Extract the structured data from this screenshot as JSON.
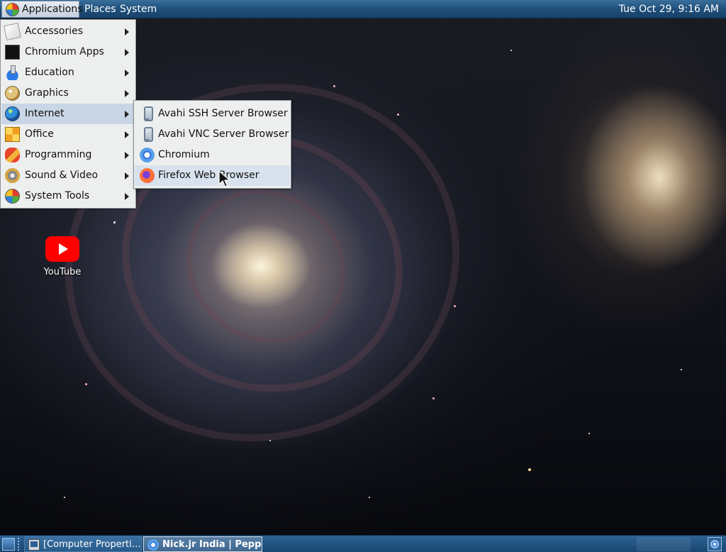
{
  "top_panel": {
    "menus": {
      "applications": "Applications",
      "places": "Places",
      "system": "System"
    },
    "clock": "Tue Oct 29,  9:16 AM"
  },
  "applications_menu": {
    "items": [
      {
        "label": "Accessories",
        "icon": "accessories-icon"
      },
      {
        "label": "Chromium Apps",
        "icon": "chromium-apps-icon"
      },
      {
        "label": "Education",
        "icon": "education-icon"
      },
      {
        "label": "Graphics",
        "icon": "graphics-icon"
      },
      {
        "label": "Internet",
        "icon": "internet-globe-icon",
        "active": true
      },
      {
        "label": "Office",
        "icon": "office-icon"
      },
      {
        "label": "Programming",
        "icon": "programming-icon"
      },
      {
        "label": "Sound & Video",
        "icon": "sound-video-icon"
      },
      {
        "label": "System Tools",
        "icon": "system-tools-icon"
      }
    ]
  },
  "internet_submenu": {
    "items": [
      {
        "label": "Avahi SSH Server Browser",
        "icon": "avahi-icon"
      },
      {
        "label": "Avahi VNC Server Browser",
        "icon": "avahi-icon"
      },
      {
        "label": "Chromium",
        "icon": "chromium-icon"
      },
      {
        "label": "Firefox Web Browser",
        "icon": "firefox-icon",
        "hovered": true
      }
    ]
  },
  "desktop": {
    "icons": [
      {
        "label": "YouTube",
        "icon": "youtube-icon"
      }
    ]
  },
  "bottom_panel": {
    "tasks": [
      {
        "label": "[Computer Properti…",
        "icon": "computer-icon"
      },
      {
        "label": "Nick.jr India | Peppa…",
        "icon": "chromium-icon",
        "active": true
      }
    ]
  },
  "colors": {
    "panel_blue": "#1f4f7a",
    "menu_background": "#edefee",
    "menu_highlight": "#c9d6e5"
  }
}
